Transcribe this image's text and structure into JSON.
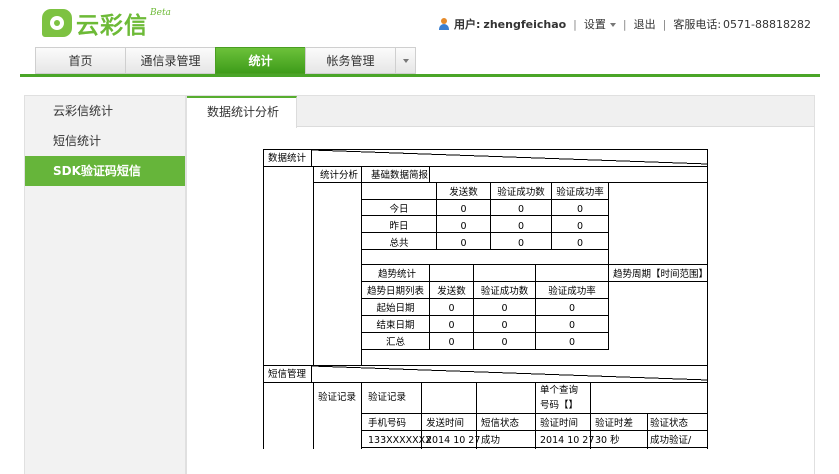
{
  "header": {
    "logo_text": "云彩信",
    "logo_badge": "Beta",
    "user_label": "用户:",
    "username": "zhengfeichao",
    "settings": "设置",
    "logout": "退出",
    "hotline_label": "客服电话:",
    "hotline": "0571-88818282"
  },
  "nav": {
    "tabs": [
      "首页",
      "通信录管理",
      "统计",
      "帐务管理"
    ],
    "active_index": 2
  },
  "sidebar": {
    "items": [
      "云彩信统计",
      "短信统计",
      "SDK验证码短信"
    ],
    "active_index": 2
  },
  "main": {
    "tab_label": "数据统计分析"
  },
  "sketch": {
    "section1": "数据统计",
    "stat_analysis": "统计分析",
    "basic_report": "基础数据简报",
    "cols": [
      "发送数",
      "验证成功数",
      "验证成功率"
    ],
    "rows": [
      {
        "label": "今日",
        "vals": [
          "0",
          "0",
          "0"
        ]
      },
      {
        "label": "昨日",
        "vals": [
          "0",
          "0",
          "0"
        ]
      },
      {
        "label": "总共",
        "vals": [
          "0",
          "0",
          "0"
        ]
      }
    ],
    "trend": "趋势统计",
    "trend_period": "趋势周期【时间范围】",
    "trend_list": "趋势日期列表",
    "trend_rows": [
      {
        "label": "起始日期",
        "vals": [
          "0",
          "0",
          "0"
        ]
      },
      {
        "label": "结束日期",
        "vals": [
          "0",
          "0",
          "0"
        ]
      },
      {
        "label": "汇总",
        "vals": [
          "0",
          "0",
          "0"
        ]
      }
    ],
    "section2": "短信管理",
    "verify_records": "验证记录",
    "verify_records2": "验证记录",
    "single_query_1": "单个查询",
    "single_query_2": "号码【】",
    "record_cols": [
      "手机号码",
      "发送时间",
      "短信状态",
      "验证时间",
      "验证时差",
      "验证状态"
    ],
    "record_row": [
      "133XXXXXXX",
      "2014 10 27",
      "成功",
      "2014 10 27",
      "30 秒",
      "成功验证/"
    ]
  }
}
